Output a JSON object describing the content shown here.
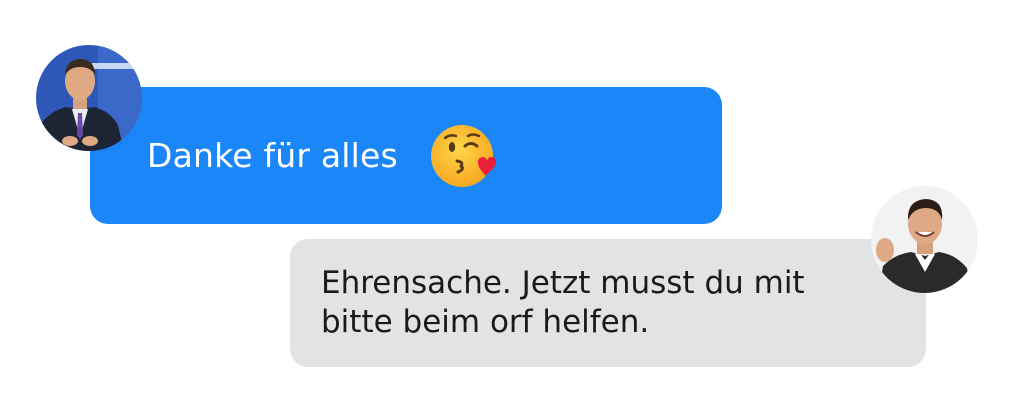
{
  "conversation": {
    "messages": [
      {
        "sender": "left",
        "text": "Danke für alles",
        "emoji": "face-throwing-a-kiss-icon",
        "bubble_color": "#1b86f8",
        "text_color": "#ffffff"
      },
      {
        "sender": "right",
        "text": "Ehrensache. Jetzt musst du mit bitte beim orf helfen.",
        "bubble_color": "#e3e3e3",
        "text_color": "#1a1a1a"
      }
    ]
  }
}
